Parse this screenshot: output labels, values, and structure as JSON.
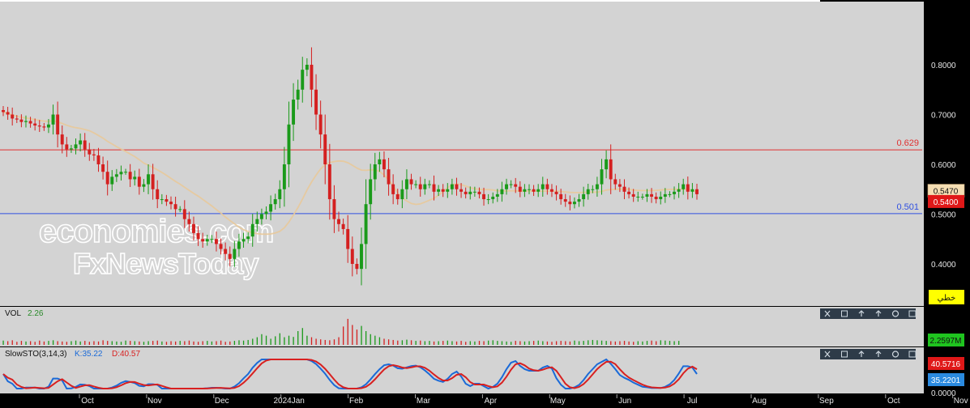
{
  "chart_data": {
    "type": "candlestick",
    "price_axis": {
      "ticks": [
        "0.8000",
        "0.7000",
        "0.6000",
        "0.5000",
        "0.4000"
      ],
      "tick_values": [
        0.8,
        0.7,
        0.6,
        0.5,
        0.4
      ],
      "ylim": [
        0.338,
        0.882
      ]
    },
    "months": [
      "Oct",
      "Nov",
      "Dec",
      "2024Jan",
      "Feb",
      "Mar",
      "Apr",
      "May",
      "Jun",
      "Jul",
      "Aug",
      "Sep",
      "Oct",
      "Nov"
    ],
    "month_positions": [
      0,
      1,
      2,
      3,
      4,
      5,
      6,
      7,
      8,
      9,
      10,
      11,
      12,
      13
    ],
    "levels": [
      {
        "label": "0.629",
        "value": 0.629,
        "color": "#e03030"
      },
      {
        "label": "0.501",
        "value": 0.501,
        "color": "#3050e0"
      }
    ],
    "last_price": {
      "label": "0.5400",
      "value": 0.54
    },
    "ma_last": {
      "label": "0.5470",
      "value": 0.547
    },
    "tool_label": "خطي",
    "watermark": {
      "line1": "economies.com",
      "line2": "FxNewsToday"
    },
    "closes": [
      0.705,
      0.7,
      0.692,
      0.69,
      0.685,
      0.687,
      0.682,
      0.678,
      0.676,
      0.674,
      0.68,
      0.7,
      0.66,
      0.64,
      0.63,
      0.632,
      0.64,
      0.648,
      0.63,
      0.62,
      0.618,
      0.6,
      0.585,
      0.56,
      0.575,
      0.58,
      0.585,
      0.585,
      0.57,
      0.575,
      0.555,
      0.56,
      0.58,
      0.55,
      0.53,
      0.53,
      0.525,
      0.52,
      0.51,
      0.51,
      0.49,
      0.48,
      0.462,
      0.45,
      0.445,
      0.45,
      0.45,
      0.44,
      0.43,
      0.42,
      0.41,
      0.43,
      0.445,
      0.45,
      0.455,
      0.48,
      0.49,
      0.5,
      0.505,
      0.52,
      0.53,
      0.55,
      0.6,
      0.68,
      0.73,
      0.75,
      0.79,
      0.8,
      0.75,
      0.7,
      0.66,
      0.6,
      0.53,
      0.49,
      0.48,
      0.47,
      0.43,
      0.4,
      0.39,
      0.44,
      0.52,
      0.57,
      0.6,
      0.61,
      0.59,
      0.56,
      0.54,
      0.53,
      0.55,
      0.57,
      0.56,
      0.56,
      0.55,
      0.56,
      0.56,
      0.545,
      0.55,
      0.545,
      0.55,
      0.56,
      0.55,
      0.545,
      0.54,
      0.545,
      0.545,
      0.54,
      0.53,
      0.53,
      0.535,
      0.54,
      0.55,
      0.56,
      0.56,
      0.555,
      0.545,
      0.55,
      0.55,
      0.545,
      0.55,
      0.56,
      0.55,
      0.545,
      0.54,
      0.53,
      0.525,
      0.52,
      0.525,
      0.53,
      0.54,
      0.55,
      0.55,
      0.56,
      0.59,
      0.61,
      0.57,
      0.56,
      0.555,
      0.545,
      0.54,
      0.535,
      0.535,
      0.535,
      0.54,
      0.535,
      0.53,
      0.535,
      0.54,
      0.54,
      0.545,
      0.55,
      0.56,
      0.545,
      0.55,
      0.54
    ],
    "volume": {
      "label": "VOL",
      "value_label": "2.26",
      "last_value_label": "2.2597M",
      "bottom_label": "0.0000",
      "values": [
        1.4,
        1.2,
        1.5,
        1.0,
        1.3,
        1.1,
        1.2,
        1.0,
        1.4,
        1.1,
        1.3,
        1.5,
        1.2,
        1.1,
        1.0,
        1.2,
        1.4,
        1.1,
        1.3,
        1.0,
        1.2,
        1.1,
        1.5,
        1.3,
        1.2,
        1.1,
        1.0,
        1.4,
        1.3,
        1.2,
        1.1,
        1.0,
        1.2,
        1.3,
        1.4,
        1.1,
        1.0,
        1.2,
        1.1,
        1.3,
        1.2,
        1.4,
        1.1,
        1.0,
        1.2,
        1.3,
        1.1,
        1.2,
        1.4,
        1.0,
        1.1,
        1.3,
        1.5,
        1.4,
        1.6,
        2.0,
        2.5,
        3.5,
        3.0,
        2.0,
        2.8,
        3.8,
        2.5,
        3.0,
        2.6,
        4.5,
        5.5,
        3.0,
        2.5,
        2.0,
        1.8,
        1.6,
        1.5,
        1.8,
        2.5,
        6.0,
        8.5,
        6.5,
        5.0,
        6.2,
        4.5,
        3.5,
        3.0,
        2.5,
        2.0,
        1.8,
        1.6,
        1.4,
        1.5,
        1.7,
        1.5,
        1.3,
        1.4,
        1.2,
        1.3,
        1.1,
        1.2,
        1.3,
        1.4,
        1.2,
        1.1,
        1.3,
        1.0,
        1.2,
        1.1,
        1.3,
        1.2,
        1.4,
        1.5,
        1.3,
        1.2,
        1.1,
        1.0,
        1.3,
        1.2,
        1.1,
        1.2,
        1.3,
        1.4,
        1.2,
        1.1,
        1.0,
        1.2,
        1.3,
        1.2,
        1.1,
        1.4,
        1.2,
        1.3,
        1.5,
        1.6,
        1.5,
        1.4,
        1.3,
        1.2,
        1.1,
        1.2,
        1.3,
        1.1,
        1.0,
        1.2,
        1.1,
        1.3,
        1.4,
        1.2,
        1.5,
        1.4,
        1.3,
        1.2,
        1.3
      ]
    },
    "stochastic": {
      "label": "SlowSTO(3,14,3)",
      "k_label": "K:35.22",
      "d_label": "D:40.57",
      "k_last_label": "35.2201",
      "d_last_label": "40.5716"
    }
  }
}
